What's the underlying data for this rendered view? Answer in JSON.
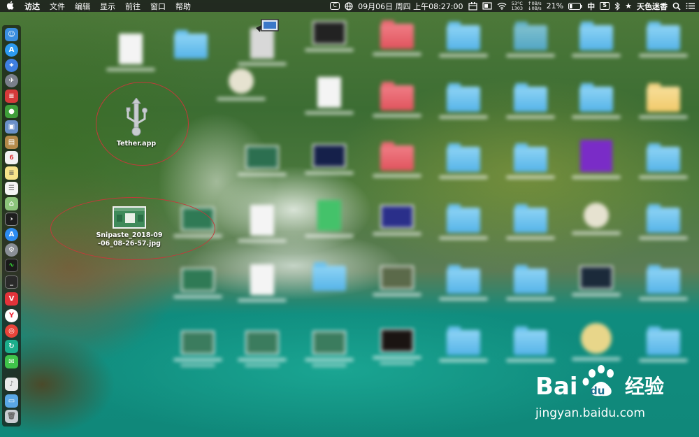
{
  "menubar": {
    "apple_icon": "apple-icon",
    "app_name": "访达",
    "menus": [
      "文件",
      "编辑",
      "显示",
      "前往",
      "窗口",
      "帮助"
    ],
    "status": {
      "copy_icon_label": "C",
      "datetime": "09月06日 周四 上午08:27:00",
      "temp_top": "53°C",
      "temp_bottom": "1303",
      "net_up": "0B/s",
      "net_down": "0B/s",
      "battery": "21%",
      "input_method": "中",
      "s_icon_label": "S",
      "user_name": "天色迷香"
    }
  },
  "desktop": {
    "tether_app": {
      "label": "Tether.app",
      "icon": "usb-icon"
    },
    "screenshot_file": {
      "label_line1": "Snipaste_2018-09",
      "label_line2": "-06_08-26-57.jpg"
    }
  },
  "dock": {
    "items": [
      "finder",
      "app-store",
      "safari",
      "launchpad",
      "tasks",
      "android",
      "preview",
      "notes",
      "calendar",
      "stickies",
      "reminders",
      "maps",
      "terminal",
      "app-store-2",
      "system-preferences",
      "activity-monitor",
      "terminal-2",
      "vivaldi",
      "yandex",
      "weibo",
      "sync",
      "wechat",
      "music",
      "folder",
      "trash"
    ]
  },
  "watermark": {
    "brand": "Bai",
    "brand2": "du",
    "cn": "经验",
    "url": "jingyan.baidu.com"
  },
  "colors": {
    "annotation_red": "#c23a3a",
    "folder_blue": "#55b3e8",
    "folder_red": "#e0535d"
  }
}
